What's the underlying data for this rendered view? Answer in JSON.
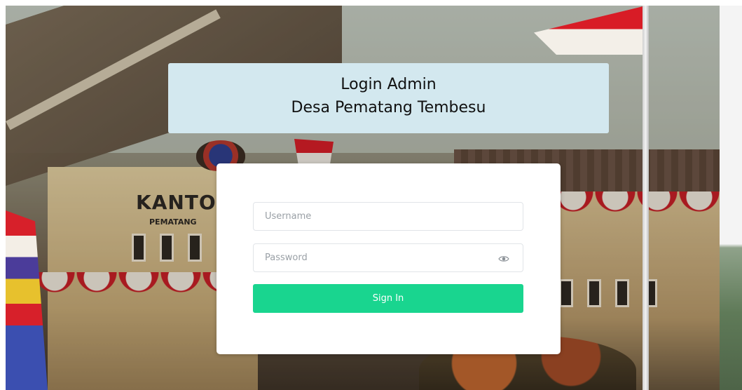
{
  "header": {
    "title_line1": "Login Admin",
    "title_line2": "Desa Pematang Tembesu"
  },
  "background": {
    "sign_text": "KANTOR",
    "sign_subtext": "PEMATANG"
  },
  "form": {
    "username_placeholder": "Username",
    "username_value": "",
    "password_placeholder": "Password",
    "password_value": "",
    "password_toggle_icon": "eye-icon",
    "signin_label": "Sign In"
  },
  "colors": {
    "title_bg": "#d3e8ef",
    "button_bg": "#19d58f",
    "card_bg": "#ffffff"
  }
}
